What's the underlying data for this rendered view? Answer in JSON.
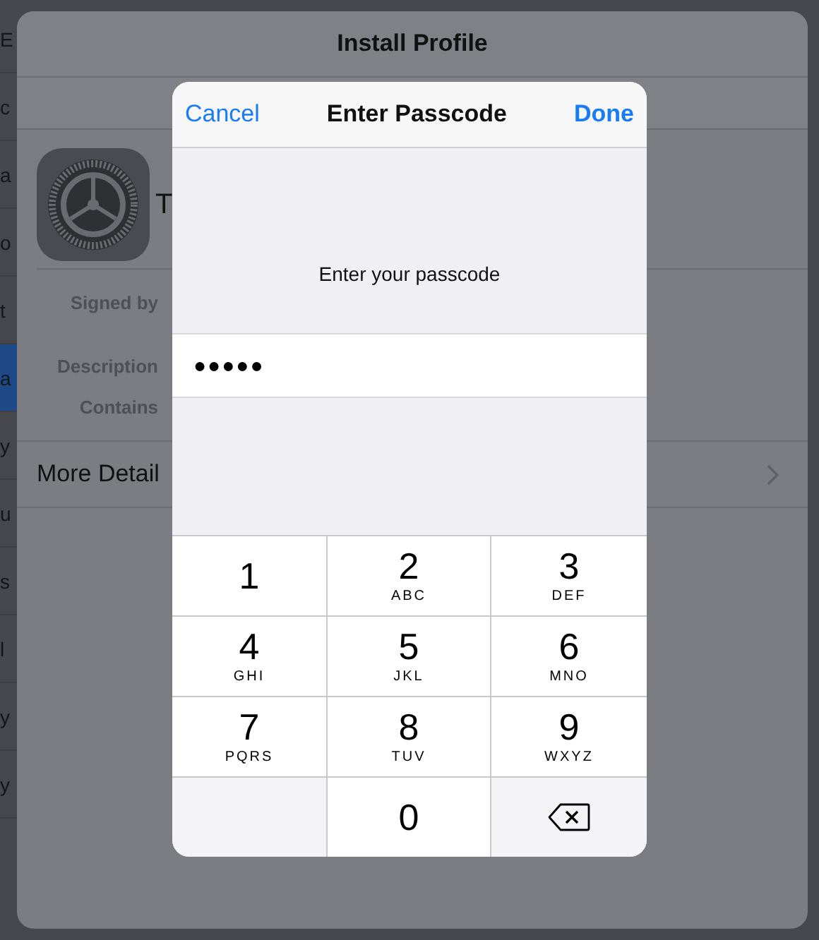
{
  "background_list": [
    {
      "text": "E",
      "selected": false
    },
    {
      "text": "c",
      "selected": false
    },
    {
      "text": "a",
      "selected": false
    },
    {
      "text": "o",
      "selected": false
    },
    {
      "text": "t",
      "selected": false
    },
    {
      "text": "a",
      "selected": true
    },
    {
      "text": "y",
      "selected": false
    },
    {
      "text": "u",
      "selected": false
    },
    {
      "text": "s",
      "selected": false
    },
    {
      "text": "l",
      "selected": false
    },
    {
      "text": "y",
      "selected": false
    },
    {
      "text": "y",
      "selected": false
    }
  ],
  "sheet": {
    "title": "Install Profile",
    "profile_name": "T",
    "fields": [
      "Signed by",
      "Description",
      "Contains"
    ],
    "more_details": "More Detail"
  },
  "dialog": {
    "cancel": "Cancel",
    "title": "Enter Passcode",
    "done": "Done",
    "prompt": "Enter your passcode",
    "passcode": "●●●●●",
    "keys": [
      {
        "kind": "digit",
        "digit": "1"
      },
      {
        "kind": "digit",
        "digit": "2",
        "letters": "ABC"
      },
      {
        "kind": "digit",
        "digit": "3",
        "letters": "DEF"
      },
      {
        "kind": "digit",
        "digit": "4",
        "letters": "GHI"
      },
      {
        "kind": "digit",
        "digit": "5",
        "letters": "JKL"
      },
      {
        "kind": "digit",
        "digit": "6",
        "letters": "MNO"
      },
      {
        "kind": "digit",
        "digit": "7",
        "letters": "PQRS"
      },
      {
        "kind": "digit",
        "digit": "8",
        "letters": "TUV"
      },
      {
        "kind": "digit",
        "digit": "9",
        "letters": "WXYZ"
      },
      {
        "kind": "blank"
      },
      {
        "kind": "digit",
        "digit": "0"
      },
      {
        "kind": "delete"
      }
    ]
  }
}
